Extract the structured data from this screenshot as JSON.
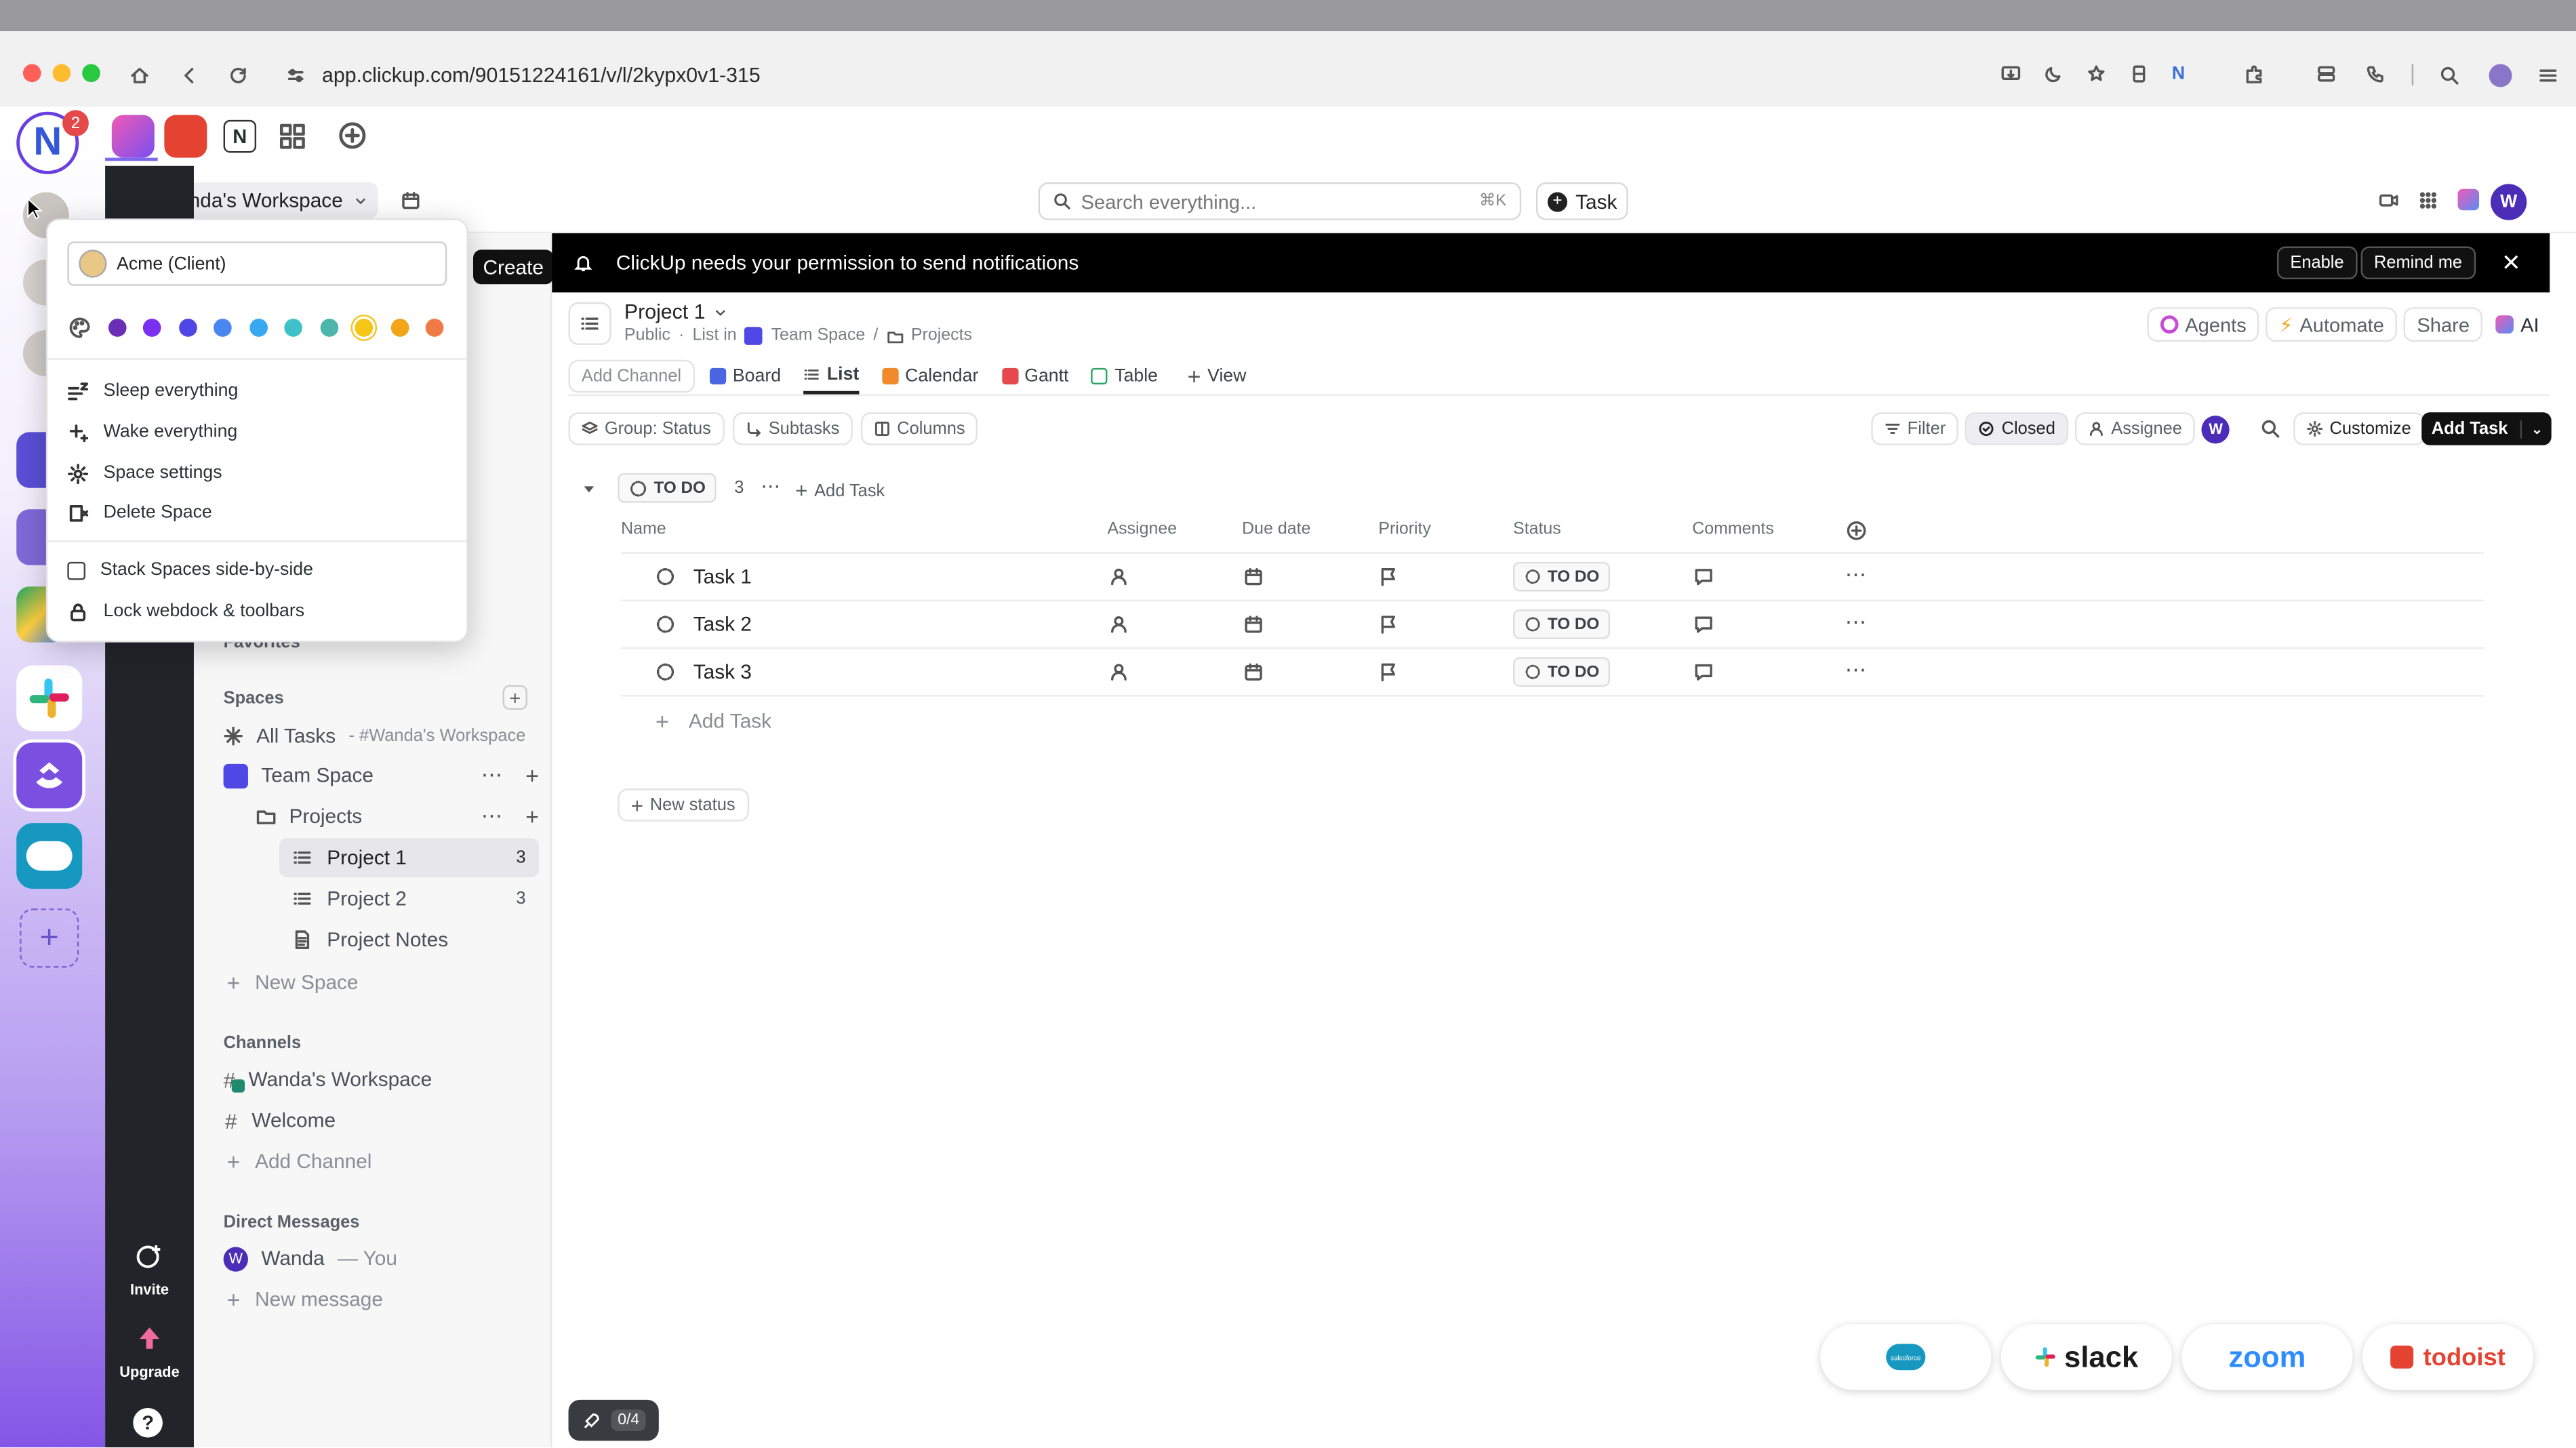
{
  "browser": {
    "url": "app.clickup.com/90151224161/v/l/2kypx0v1-315",
    "notion_badge": "2"
  },
  "header": {
    "workspace_name": "Wanda's Workspace",
    "workspace_initial": "W",
    "search_placeholder": "Search everything...",
    "search_shortcut": "⌘K",
    "task_button": "Task",
    "user_initial": "W"
  },
  "create_button": "Create",
  "banner": {
    "text": "ClickUp needs your permission to send notifications",
    "enable": "Enable",
    "remind": "Remind me"
  },
  "rail": {
    "invite": "Invite",
    "upgrade": "Upgrade",
    "help": "?"
  },
  "popup": {
    "client_input": "Acme (Client)",
    "colors": [
      "#6b2fb7",
      "#7b2ff0",
      "#5046e4",
      "#4a86f0",
      "#38a9f0",
      "#3fc1c9",
      "#4db6ac",
      "#f5c518",
      "#f2a516",
      "#ef7a45"
    ],
    "items": [
      "Sleep everything",
      "Wake everything",
      "Space settings",
      "Delete Space"
    ],
    "items2": [
      "Stack Spaces side-by-side",
      "Lock webdock & toolbars"
    ]
  },
  "sidebar": {
    "favorites": "Favorites",
    "spaces_label": "Spaces",
    "all_tasks": "All Tasks",
    "all_tasks_sub": "- #Wanda's Workspace",
    "team_space": "Team Space",
    "projects": "Projects",
    "project1": "Project 1",
    "project1_count": "3",
    "project2": "Project 2",
    "project2_count": "3",
    "project_notes": "Project Notes",
    "new_space": "New Space",
    "channels_label": "Channels",
    "channel1": "Wanda's Workspace",
    "channel2": "Welcome",
    "add_channel": "Add Channel",
    "dm_label": "Direct Messages",
    "dm_user": "Wanda",
    "dm_you": "— You",
    "new_message": "New message"
  },
  "list_header": {
    "title": "Project 1",
    "crumb_public": "Public",
    "crumb_list_in": "List in",
    "crumb_space": "Team Space",
    "crumb_sep": "/",
    "crumb_folder": "Projects",
    "agents": "Agents",
    "automate": "Automate",
    "share": "Share",
    "ai": "AI"
  },
  "view_tabs": {
    "add_channel": "Add Channel",
    "board": "Board",
    "list": "List",
    "calendar": "Calendar",
    "gantt": "Gantt",
    "table": "Table",
    "view": "View"
  },
  "toolbar": {
    "group": "Group: Status",
    "subtasks": "Subtasks",
    "columns": "Columns",
    "filter": "Filter",
    "closed": "Closed",
    "assignee": "Assignee",
    "customize": "Customize",
    "add_task": "Add Task"
  },
  "group": {
    "status": "TO DO",
    "count": "3",
    "add_task": "Add Task",
    "new_status": "New status"
  },
  "table": {
    "columns": [
      "Name",
      "Assignee",
      "Due date",
      "Priority",
      "Status",
      "Comments"
    ],
    "rows": [
      {
        "name": "Task 1",
        "status": "TO DO"
      },
      {
        "name": "Task 2",
        "status": "TO DO"
      },
      {
        "name": "Task 3",
        "status": "TO DO"
      }
    ],
    "add_task": "Add Task"
  },
  "integrations": {
    "salesforce": "salesforce",
    "slack": "slack",
    "zoom": "zoom",
    "todoist": "todoist"
  },
  "onboarding": "0/4"
}
